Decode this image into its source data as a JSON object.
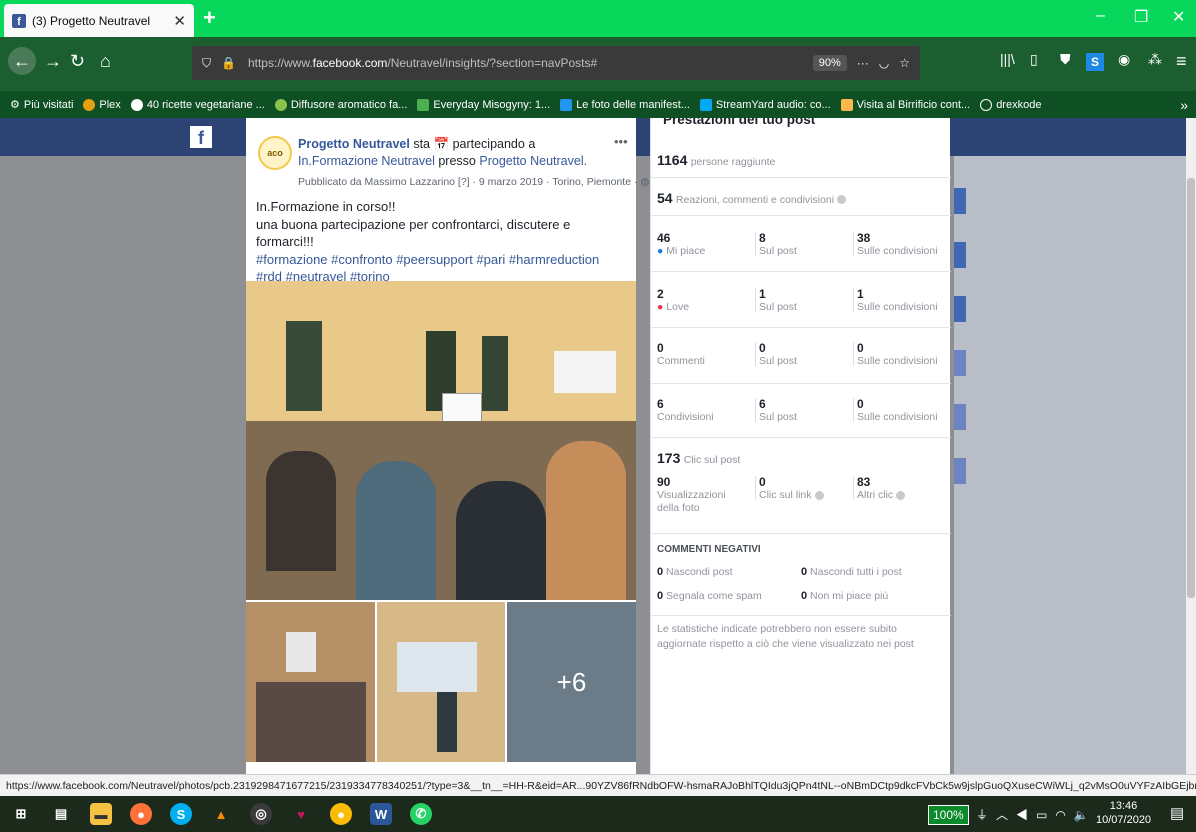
{
  "browser": {
    "tab_title": "(3) Progetto Neutravel",
    "url_prefix": "https://www.",
    "url_domain": "facebook.com",
    "url_path": "/Neutravel/insights/?section=navPosts#",
    "zoom": "90%",
    "bookmarks": [
      "Più visitati",
      "Plex",
      "40 ricette vegetariane ...",
      "Diffusore aromatico fa...",
      "Everyday Misogyny: 1...",
      "Le foto delle manifest...",
      "StreamYard audio: co...",
      "Visita al Birrificio cont...",
      "drexkode"
    ]
  },
  "post": {
    "page_name": "Progetto Neutravel",
    "connector": "sta",
    "event_phrase": "partecipando a",
    "event_name": "In.Formazione Neutravel",
    "presso": "presso",
    "place": "Progetto Neutravel.",
    "meta": "Pubblicato da Massimo Lazzarino [?] · 9 marzo 2019 · Torino, Piemonte ·",
    "text_line1": "In.Formazione in corso!!",
    "text_line2": "una buona partecipazione per confrontarci, discutere e formarci!!!",
    "hashtags": "#formazione #confronto #peersupport #pari #harmreduction #rdd #neutravel #torino",
    "more_photos": "+6"
  },
  "stats": {
    "title": "Prestazioni del tuo post",
    "reach_value": "1164",
    "reach_label": "persone raggiunte",
    "engagement_value": "54",
    "engagement_label": "Reazioni, commenti e condivisioni",
    "grid": [
      {
        "v1": "46",
        "l1": "Mi piace",
        "v2": "8",
        "l2": "Sul post",
        "v3": "38",
        "l3": "Sulle condivisioni"
      },
      {
        "v1": "2",
        "l1": "Love",
        "v2": "1",
        "l2": "Sul post",
        "v3": "1",
        "l3": "Sulle condivisioni"
      },
      {
        "v1": "0",
        "l1": "Commenti",
        "v2": "0",
        "l2": "Sul post",
        "v3": "0",
        "l3": "Sulle condivisioni"
      },
      {
        "v1": "6",
        "l1": "Condivisioni",
        "v2": "6",
        "l2": "Sul post",
        "v3": "0",
        "l3": "Sulle condivisioni"
      }
    ],
    "clicks_value": "173",
    "clicks_label": "Clic sul post",
    "clicks": [
      {
        "v": "90",
        "l": "Visualizzazioni della foto"
      },
      {
        "v": "0",
        "l": "Clic sul link"
      },
      {
        "v": "83",
        "l": "Altri clic"
      }
    ],
    "neg_title": "COMMENTI NEGATIVI",
    "neg": [
      {
        "v": "0",
        "l": "Nascondi post"
      },
      {
        "v": "0",
        "l": "Nascondi tutti i post"
      },
      {
        "v": "0",
        "l": "Segnala come spam"
      },
      {
        "v": "0",
        "l": "Non mi piace più"
      }
    ],
    "note": "Le statistiche indicate potrebbero non essere subito aggiornate rispetto a ciò che viene visualizzato nei post"
  },
  "status_url": "https://www.facebook.com/Neutravel/photos/pcb.2319298471677215/2319334778340251/?type=3&__tn__=HH-R&eid=AR...90YZV86fRNdbOFW-hsmaRAJoBhlTQIdu3jQPn4tNL--oNBmDCtp9dkcFVbCk5w9jslpGuoQXuseCWiWLj_q2vMsO0uVYFzAIbGEjbryEl",
  "taskbar": {
    "battery_pct": "100%",
    "time": "13:46",
    "date": "10/07/2020"
  }
}
